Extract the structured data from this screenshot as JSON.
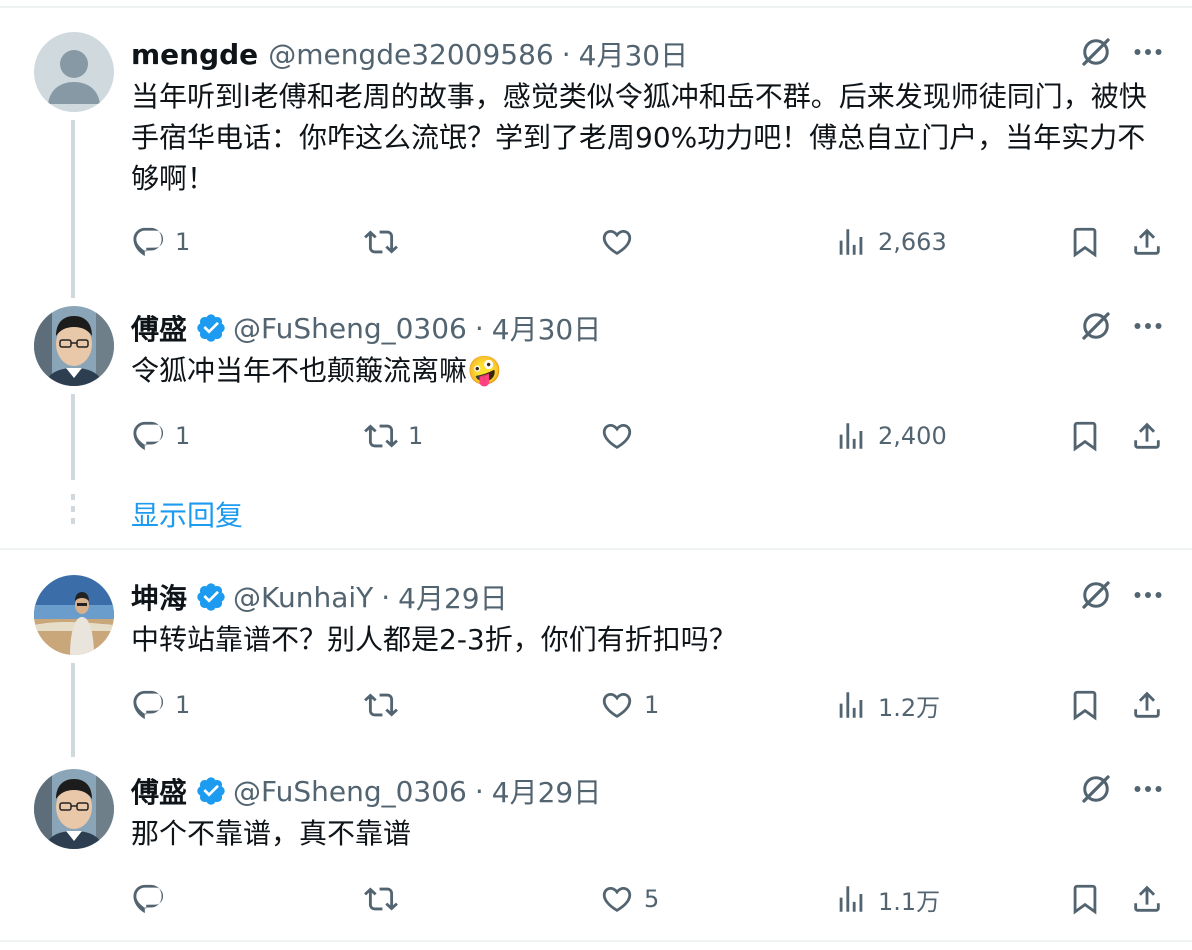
{
  "tweets": [
    {
      "name": "mengde",
      "handle": "@mengde32009586",
      "date": "4月30日",
      "text": "当年听到l老傅和老周的故事，感觉类似令狐冲和岳不群。后来发现师徒同门，被快手宿华电话：你咋这么流氓？学到了老周90%功力吧！傅总自立门户，当年实力不够啊！",
      "verified": false,
      "avatar": "default-avatar",
      "replies": "1",
      "retweets": "",
      "likes": "",
      "views": "2,663"
    },
    {
      "name": "傅盛",
      "handle": "@FuSheng_0306",
      "date": "4月30日",
      "text": "令狐冲当年不也颠簸流离嘛🤪",
      "verified": true,
      "avatar": "person-photo",
      "replies": "1",
      "retweets": "1",
      "likes": "",
      "views": "2,400"
    },
    {
      "name": "坤海",
      "handle": "@KunhaiY",
      "date": "4月29日",
      "text": "中转站靠谱不？别人都是2-3折，你们有折扣吗？",
      "verified": true,
      "avatar": "beach-photo",
      "replies": "1",
      "retweets": "",
      "likes": "1",
      "views": "1.2万"
    },
    {
      "name": "傅盛",
      "handle": "@FuSheng_0306",
      "date": "4月29日",
      "text": "那个不靠谱，真不靠谱",
      "verified": true,
      "avatar": "person-photo",
      "replies": "",
      "retweets": "",
      "likes": "5",
      "views": "1.1万"
    }
  ],
  "show_replies_label": "显示回复",
  "separator": "·",
  "colors": {
    "text": "#0f1419",
    "muted": "#536471",
    "accent": "#1d9bf0",
    "thread_line": "#cfd9de",
    "divider": "#eff3f4"
  }
}
